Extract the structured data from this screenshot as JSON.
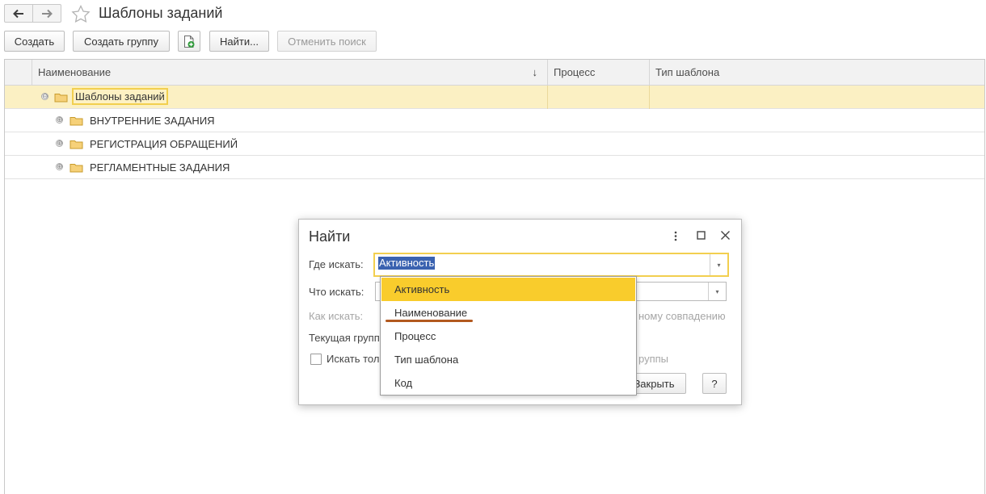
{
  "window": {
    "title": "Шаблоны заданий",
    "nav": {
      "back_icon": "arrow-left-icon",
      "forward_icon": "arrow-right-icon",
      "favorite_icon": "star-outline-icon"
    }
  },
  "toolbar": {
    "create": "Создать",
    "create_group": "Создать группу",
    "create_copy_icon": "document-add-icon",
    "find": "Найти...",
    "cancel_search": "Отменить поиск"
  },
  "table": {
    "columns": [
      {
        "label": "Наименование",
        "sort_indicator": "↓"
      },
      {
        "label": "Процесс"
      },
      {
        "label": "Тип шаблона"
      }
    ],
    "rows": [
      {
        "label": "Шаблоны заданий",
        "expander": "⊖",
        "selected": true
      },
      {
        "label": "ВНУТРЕННИЕ ЗАДАНИЯ",
        "expander": "⊕",
        "selected": false
      },
      {
        "label": "РЕГИСТРАЦИЯ ОБРАЩЕНИЙ",
        "expander": "⊕",
        "selected": false
      },
      {
        "label": "РЕГЛАМЕНТНЫЕ ЗАДАНИЯ",
        "expander": "⊕",
        "selected": false
      }
    ]
  },
  "find_dialog": {
    "title": "Найти",
    "where_label": "Где искать:",
    "where_value": "Активность",
    "what_label": "Что искать:",
    "how_label": "Как искать:",
    "how_value_partial": "ному совпадению",
    "current_group_label": "Текущая групп",
    "search_only_label": "Искать тол",
    "search_only_suffix": "руппы",
    "close_button": "Закрыть",
    "help_button": "?"
  },
  "dropdown": {
    "items": [
      "Активность",
      "Наименование",
      "Процесс",
      "Тип шаблона",
      "Код"
    ],
    "highlighted_index": 0
  },
  "colors": {
    "selection_row": "#fbf0c3",
    "focus_border": "#f2cf4f",
    "dropdown_highlight": "#f9cc2c",
    "text_selection": "#3a62b0",
    "annotation_underline": "#b2591f"
  }
}
